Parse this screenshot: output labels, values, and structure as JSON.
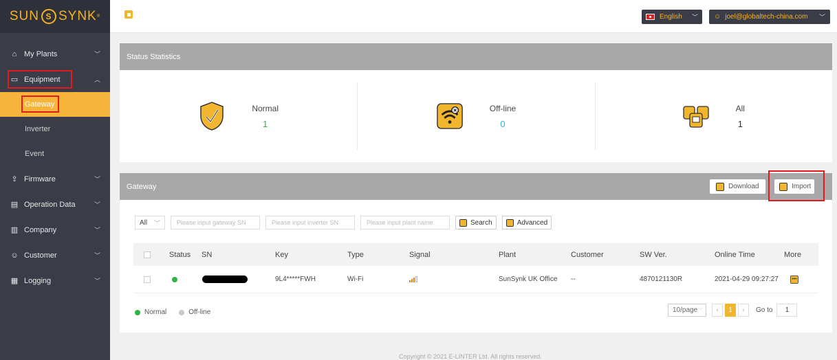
{
  "app": {
    "logo_left": "SUN",
    "logo_right": "SYNK",
    "brand_color": "#f5b324"
  },
  "sidebar": {
    "items": [
      {
        "label": "My Plants",
        "icon": "home-icon"
      },
      {
        "label": "Equipment",
        "icon": "monitor-icon"
      },
      {
        "label": "Firmware",
        "icon": "upload-icon"
      },
      {
        "label": "Operation Data",
        "icon": "calendar-icon"
      },
      {
        "label": "Company",
        "icon": "building-icon"
      },
      {
        "label": "Customer",
        "icon": "users-icon"
      },
      {
        "label": "Logging",
        "icon": "log-icon"
      }
    ],
    "equipment_sub": [
      "Gateway",
      "Inverter",
      "Event"
    ]
  },
  "topbar": {
    "language": "English",
    "user": "joel@globaltech-china.com"
  },
  "stats": {
    "title": "Status Statistics",
    "normal_label": "Normal",
    "normal_value": "1",
    "offline_label": "Off-line",
    "offline_value": "0",
    "all_label": "All",
    "all_value": "1",
    "normal_color": "#2fb344",
    "offline_color": "#2bb3d8"
  },
  "gateway": {
    "title": "Gateway",
    "download_label": "Download",
    "import_label": "Import",
    "filter_select": "All",
    "gateway_sn_placeholder": "Please input gateway SN",
    "inverter_sn_placeholder": "Please input inverter SN",
    "plant_name_placeholder": "Please input plant name",
    "search_label": "Search",
    "advanced_label": "Advanced",
    "columns": [
      "Status",
      "SN",
      "Key",
      "Type",
      "Signal",
      "Plant",
      "Customer",
      "SW Ver.",
      "Online Time",
      "More"
    ],
    "rows": [
      {
        "key": "9L4*****FWH",
        "type": "Wi-Fi",
        "plant": "SunSynk UK Office",
        "customer": "--",
        "sw_ver": "4870121130R",
        "online_time": "2021-04-29 09:27:27"
      }
    ],
    "legend_normal": "Normal",
    "legend_offline": "Off-line",
    "page_size": "10/page",
    "current_page": "1",
    "goto_label": "Go to",
    "goto_value": "1"
  },
  "footer": "Copyright © 2021 E-LINTER Ltd. All rights reserved."
}
